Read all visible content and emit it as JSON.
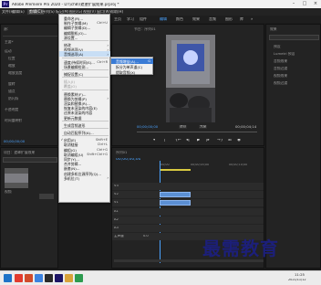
{
  "window": {
    "title": "Adobe Premiere Pro 2020 - D:\\\\ch8\\\\遮罩扩展效果.prproj *",
    "logo": "Pr"
  },
  "menubar": {
    "items": [
      {
        "label": "文件(F)",
        "active": false
      },
      {
        "label": "编辑(E)",
        "active": false
      },
      {
        "label": "剪辑(C)",
        "active": true
      },
      {
        "label": "序列(S)",
        "active": false
      },
      {
        "label": "标记(M)",
        "active": false
      },
      {
        "label": "图形(G)",
        "active": false
      },
      {
        "label": "视图(V)",
        "active": false
      },
      {
        "label": "窗口(W)",
        "active": false
      },
      {
        "label": "帮助(H)",
        "active": false
      }
    ]
  },
  "workspace_tabs": [
    {
      "label": "主页",
      "active": false
    },
    {
      "label": "学习",
      "active": false
    },
    {
      "label": "组件",
      "active": false
    },
    {
      "label": "编辑",
      "active": true
    },
    {
      "label": "颜色",
      "active": false
    },
    {
      "label": "效果",
      "active": false
    },
    {
      "label": "音频",
      "active": false
    },
    {
      "label": "图形",
      "active": false
    },
    {
      "label": "库",
      "active": false
    },
    {
      "label": "»",
      "active": false
    }
  ],
  "clip_menu": {
    "items": [
      {
        "label": "重命名(R)...",
        "shortcut": "",
        "type": "item"
      },
      {
        "label": "制作子剪辑(M)",
        "shortcut": "Ctrl+U",
        "type": "item"
      },
      {
        "label": "编辑子剪辑(D)...",
        "shortcut": "",
        "type": "item"
      },
      {
        "label": "编辑脱机(O)...",
        "shortcut": "",
        "type": "item"
      },
      {
        "label": "源设置...",
        "shortcut": "",
        "type": "item"
      },
      {
        "type": "sep"
      },
      {
        "label": "修改",
        "shortcut": "",
        "type": "sub"
      },
      {
        "label": "视频选项(V)",
        "shortcut": "",
        "type": "sub"
      },
      {
        "label": "音频选项(A)",
        "shortcut": "",
        "type": "sub",
        "highlighted": true
      },
      {
        "type": "sep"
      },
      {
        "label": "速度/持续时间(S)...",
        "shortcut": "Ctrl+R",
        "type": "item"
      },
      {
        "label": "场景编辑检测...",
        "shortcut": "",
        "type": "item"
      },
      {
        "type": "sep"
      },
      {
        "label": "捕捉设置(C)",
        "shortcut": "",
        "type": "item"
      },
      {
        "type": "sep"
      },
      {
        "label": "插入(I)",
        "shortcut": "",
        "type": "item",
        "disabled": true
      },
      {
        "label": "覆盖(O)",
        "shortcut": "",
        "type": "item",
        "disabled": true
      },
      {
        "type": "sep"
      },
      {
        "label": "替换素材(F)...",
        "shortcut": "",
        "type": "item"
      },
      {
        "label": "替换为剪辑(P)",
        "shortcut": "",
        "type": "sub"
      },
      {
        "label": "渲染和替换(R)...",
        "shortcut": "",
        "type": "item"
      },
      {
        "label": "恢复未渲染的内容(E)",
        "shortcut": "",
        "type": "item"
      },
      {
        "label": "还原未渲染的内容",
        "shortcut": "",
        "type": "item"
      },
      {
        "label": "更新元数据",
        "shortcut": "",
        "type": "item"
      },
      {
        "type": "sep"
      },
      {
        "label": "生成音频波形",
        "shortcut": "",
        "type": "item"
      },
      {
        "type": "sep"
      },
      {
        "label": "自动匹配序列(A)...",
        "shortcut": "",
        "type": "item"
      },
      {
        "type": "sep"
      },
      {
        "label": "启用(E)",
        "shortcut": "Shift+E",
        "type": "item",
        "checked": true
      },
      {
        "label": "取消链接",
        "shortcut": "Ctrl+L",
        "type": "item"
      },
      {
        "label": "编组(G)",
        "shortcut": "Ctrl+G",
        "type": "item"
      },
      {
        "label": "取消编组(U)",
        "shortcut": "Shift+Ctrl+G",
        "type": "item"
      },
      {
        "label": "同步(Y)...",
        "shortcut": "",
        "type": "item"
      },
      {
        "label": "合并剪辑...",
        "shortcut": "",
        "type": "item"
      },
      {
        "label": "嵌套(N)...",
        "shortcut": "",
        "type": "item"
      },
      {
        "label": "创建多机位源序列(Q)...",
        "shortcut": "",
        "type": "item"
      },
      {
        "label": "多机位(T)",
        "shortcut": "",
        "type": "sub"
      }
    ]
  },
  "audio_submenu": {
    "items": [
      {
        "label": "音频增益(A)...",
        "shortcut": "G",
        "highlighted": true
      },
      {
        "label": "拆分为单声道(C)",
        "shortcut": ""
      },
      {
        "label": "提取音频(X)",
        "shortcut": ""
      }
    ]
  },
  "left_panel": {
    "tab": "源：",
    "rows": [
      "主要*",
      "运动",
      "位置",
      "缩放",
      "缩放宽度",
      "旋转",
      "锚点",
      "防闪烁",
      "不透明度",
      "时间重映射"
    ]
  },
  "program_monitor": {
    "tab": "节目：序列01",
    "timecode_left": "00;00;00;00",
    "fit": "适合",
    "quality": "完整",
    "timecode_right": "00;00;04;14"
  },
  "source_timecode": "00;00;00;00",
  "effects_panel": {
    "tab": "效果",
    "items": [
      "预设",
      "Lumetri 预设",
      "音频效果",
      "音频过渡",
      "视频效果",
      "视频过渡"
    ]
  },
  "project_panel": {
    "tab": "项目：遮罩扩展效果",
    "item_label": "视频"
  },
  "timeline": {
    "tab": "序列01",
    "timecode": "00;00;00;00",
    "ruler": [
      ";00;00",
      "00;00;05;00",
      "00;00;10;00"
    ],
    "tracks": [
      "V3",
      "V2",
      "V1",
      "A1",
      "A2",
      "A3"
    ],
    "master_label": "主声道",
    "master_value": "0.0"
  },
  "taskbar": {
    "time": "11:25",
    "date": "2021/11/12"
  },
  "watermark": "最需教育",
  "colors": {
    "accent": "#4aa3ff",
    "menu_highlight": "#c8def5",
    "submenu_highlight": "#3a7bd5",
    "clip_blue": "#5b8fd3",
    "watermark": "#1c1f7a"
  }
}
